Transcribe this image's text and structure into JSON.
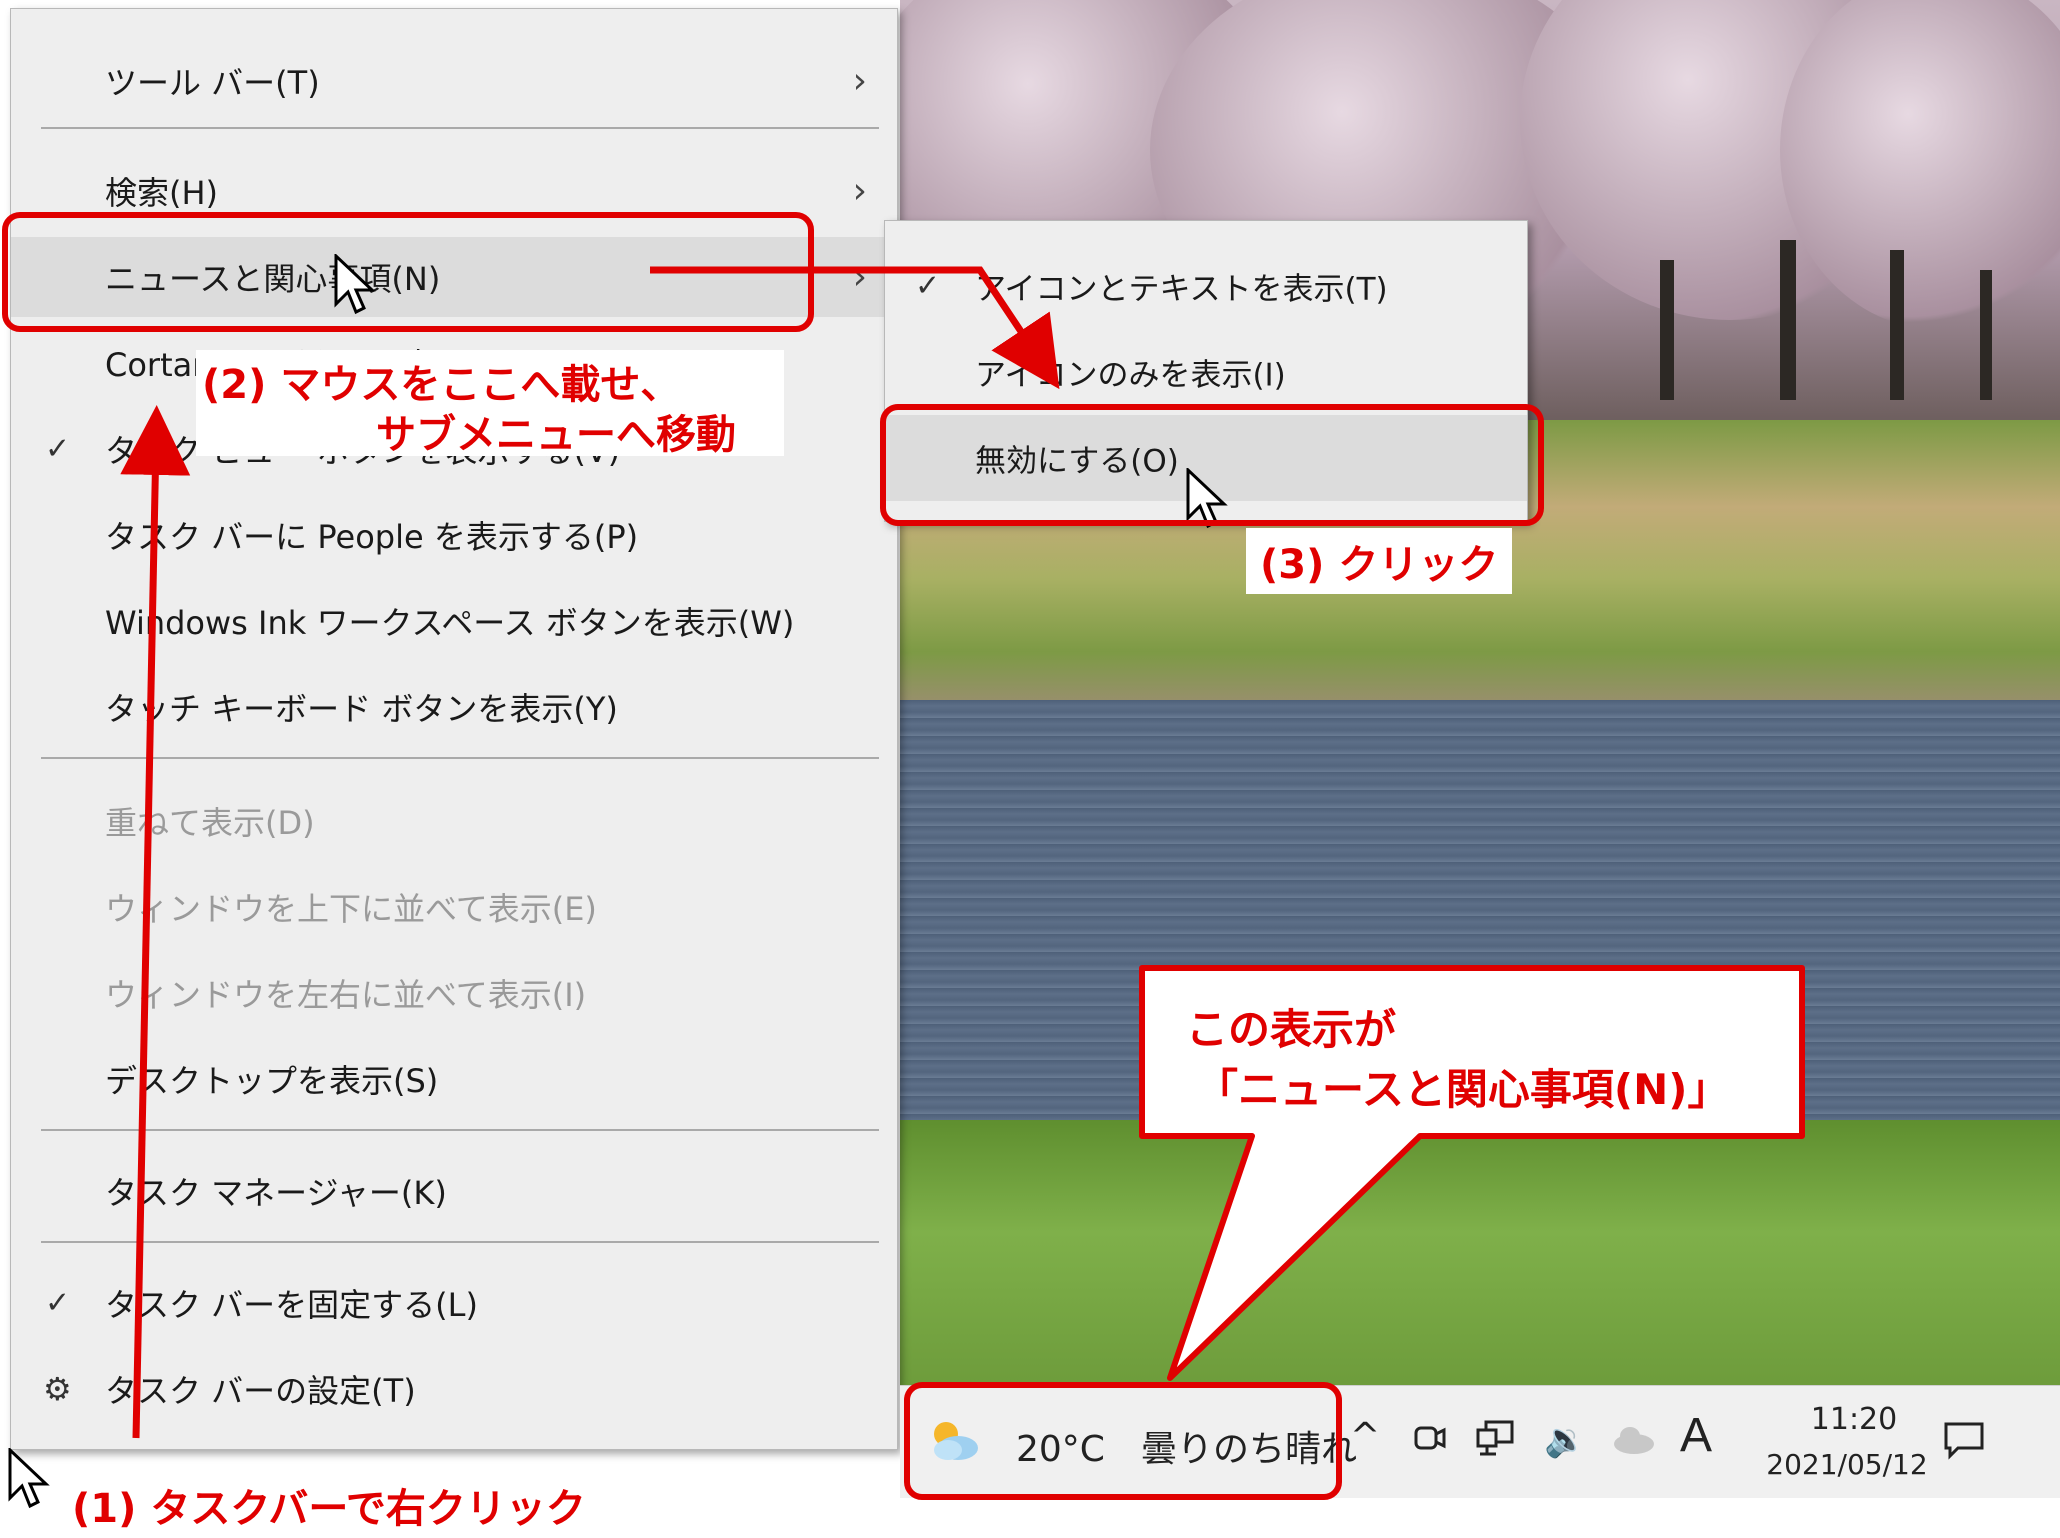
{
  "context_menu": {
    "items": [
      {
        "label": "ツール バー(T)",
        "submenu": true
      },
      {
        "label": "検索(H)",
        "submenu": true
      },
      {
        "label": "ニュースと関心事項(N)",
        "submenu": true,
        "highlighted": true
      },
      {
        "label": "Cortana のボタンを表示する(O)"
      },
      {
        "label": "タスク ビュー ボタンを表示する(V)",
        "checked": true
      },
      {
        "label": "タスク バーに People を表示する(P)"
      },
      {
        "label": "Windows Ink ワークスペース ボタンを表示(W)"
      },
      {
        "label": "タッチ キーボード ボタンを表示(Y)"
      },
      {
        "label": "重ねて表示(D)",
        "disabled": true
      },
      {
        "label": "ウィンドウを上下に並べて表示(E)",
        "disabled": true
      },
      {
        "label": "ウィンドウを左右に並べて表示(I)",
        "disabled": true
      },
      {
        "label": "デスクトップを表示(S)"
      },
      {
        "label": "タスク マネージャー(K)"
      },
      {
        "label": "タスク バーを固定する(L)",
        "checked": true
      },
      {
        "label": "タスク バーの設定(T)",
        "icon": "gear-icon"
      }
    ]
  },
  "submenu": {
    "items": [
      {
        "label": "アイコンとテキストを表示(T)",
        "checked": true
      },
      {
        "label": "アイコンのみを表示(I)"
      },
      {
        "label": "無効にする(O)",
        "highlighted": true
      }
    ]
  },
  "taskbar": {
    "weather_icon": "partly-cloudy-icon",
    "weather": "20°C　曇りのち晴れ",
    "tray_chevron": "^",
    "ime": "A",
    "time": "11:20",
    "date": "2021/05/12"
  },
  "annotations": {
    "step1": "(1) タスクバーで右クリック",
    "step2_line1": "(2) マウスをここへ載せ、",
    "step2_line2": "サブメニューへ移動",
    "step3": "(3) クリック",
    "callout_line1": "この表示が",
    "callout_line2": "「ニュースと関心事項(N)」"
  },
  "colors": {
    "annotation_red": "#e00000",
    "menu_background": "#eeeeee",
    "disabled_text": "#9a9a9a"
  }
}
